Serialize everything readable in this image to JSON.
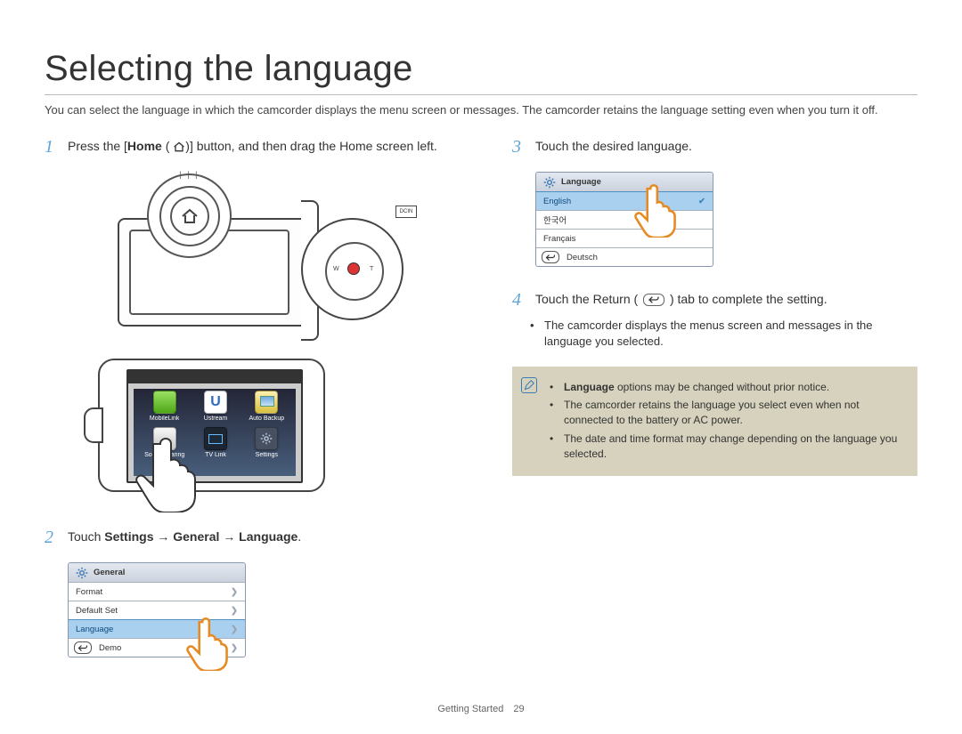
{
  "title": "Selecting the language",
  "intro": "You can select the language in which the camcorder displays the menu screen or messages. The camcorder retains the language setting even when you turn it off.",
  "step1": {
    "n": "1",
    "pre": "Press the [",
    "home_bold": "Home",
    "post": " ( ) ] button, and then drag the Home screen left."
  },
  "device_labels": {
    "dcin": "DCIN",
    "w": "W",
    "t": "T"
  },
  "apps": [
    {
      "label": "MobileLink",
      "cls": "ic-mobilelink"
    },
    {
      "label": "Ustream",
      "cls": "ic-ustream"
    },
    {
      "label": "Auto Backup",
      "cls": "ic-autobackup"
    },
    {
      "label": "Social Sharing",
      "cls": "ic-social"
    },
    {
      "label": "TV Link",
      "cls": "ic-tvlink"
    },
    {
      "label": "Settings",
      "cls": "ic-settings"
    }
  ],
  "step2": {
    "n": "2",
    "pre": "Touch ",
    "bold": "Settings → General → Language",
    "post": "."
  },
  "panel_general": {
    "header": "General",
    "rows": [
      {
        "label": "Format",
        "chev": true
      },
      {
        "label": "Default Set",
        "chev": true
      },
      {
        "label": "Language",
        "chev": true,
        "selected": true
      },
      {
        "label": "Demo",
        "chev": true,
        "back": true
      }
    ]
  },
  "step3": {
    "n": "3",
    "text": "Touch the desired language."
  },
  "panel_language": {
    "header": "Language",
    "rows": [
      {
        "label": "English",
        "selected": true,
        "check": true
      },
      {
        "label": "한국어"
      },
      {
        "label": "Français"
      },
      {
        "label": "Deutsch",
        "back": true
      }
    ]
  },
  "step4": {
    "n": "4",
    "pre": "Touch the Return ( ",
    "post": " ) tab to complete the setting.",
    "sub": "The camcorder displays the menus screen and messages in the language you selected."
  },
  "notes": [
    {
      "bold": "Language",
      "rest": " options may be changed without prior notice."
    },
    {
      "rest": "The camcorder retains the language you select even when not connected to the battery or AC power."
    },
    {
      "rest": "The date and time format may change depending on the language you selected."
    }
  ],
  "footer": {
    "section": "Getting Started",
    "page": "29"
  }
}
